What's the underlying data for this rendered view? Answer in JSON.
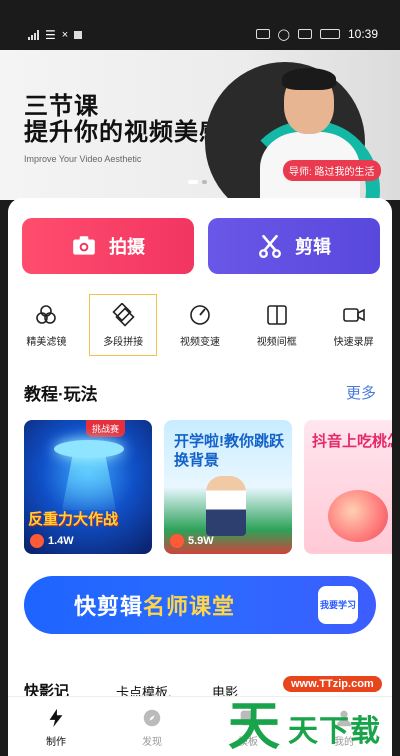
{
  "status_bar": {
    "time": "10:39",
    "battery": "",
    "icons": [
      "signal-icon",
      "wifi-icon",
      "nfc-icon",
      "notification-icon",
      "hd-icon",
      "alarm-icon",
      "sim-icon",
      "battery-icon"
    ]
  },
  "banner": {
    "title_line1": "三节课",
    "title_line2": "提升你的视频美感",
    "subtitle": "Improve Your Video Aesthetic",
    "teacher_tag": "导师: 路过我的生活"
  },
  "actions": {
    "shoot_label": "拍摄",
    "edit_label": "剪辑"
  },
  "tools": [
    {
      "label": "精美滤镜",
      "icon": "filter-icon"
    },
    {
      "label": "多段拼接",
      "icon": "splice-icon"
    },
    {
      "label": "视频变速",
      "icon": "speed-icon"
    },
    {
      "label": "视频间框",
      "icon": "frame-icon"
    },
    {
      "label": "快速录屏",
      "icon": "screen-record-icon"
    }
  ],
  "tutorials": {
    "title": "教程·玩法",
    "more_label": "更多",
    "cards": [
      {
        "caption": "反重力大作战",
        "badge": "挑战赛",
        "views": "1.4W"
      },
      {
        "caption": "开学啦!教你跳跃换背景",
        "views": "5.9W"
      },
      {
        "caption": "抖音上吃桃怎么",
        "views": ""
      }
    ]
  },
  "promo": {
    "prefix": "快剪辑",
    "highlight": "名师课堂",
    "learn_label": "我要学习"
  },
  "bottom_strip": {
    "item1": "快影记",
    "item2": "卡点模板.",
    "item3": "电影"
  },
  "nav": [
    {
      "label": "制作",
      "icon": "lightning-icon",
      "active": true
    },
    {
      "label": "发现",
      "icon": "compass-icon",
      "active": false
    },
    {
      "label": "模板",
      "icon": "template-icon",
      "active": false
    },
    {
      "label": "我的",
      "icon": "profile-icon",
      "active": false
    }
  ],
  "watermark": {
    "site": "www.TTzip.com",
    "brand_big": "天",
    "brand_small": "天下载"
  },
  "colors": {
    "shoot": "#f23562",
    "edit": "#5848dc",
    "more_link": "#4a7bd8",
    "promo": "#2a6bff",
    "accent_yellow": "#ffd64a"
  }
}
